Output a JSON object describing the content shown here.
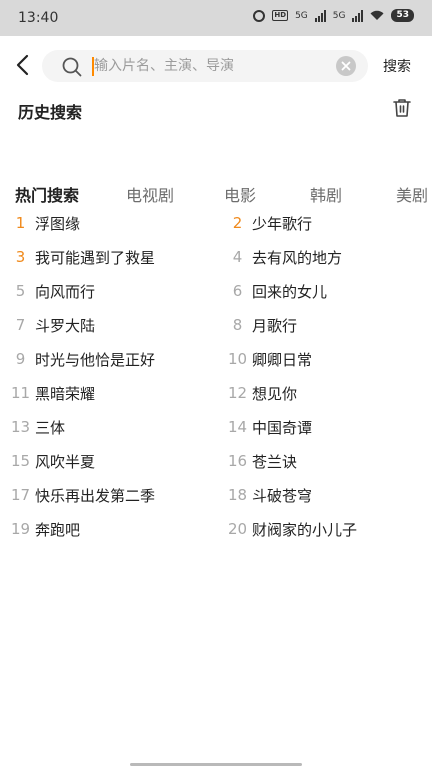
{
  "status_bar": {
    "time": "13:40",
    "hd_tag": "HD",
    "network_1": "5G",
    "network_2": "5G",
    "battery": "53"
  },
  "header": {
    "back_icon": "back-arrow-icon",
    "search": {
      "placeholder": "输入片名、主演、导演",
      "value": "",
      "icon": "search-icon",
      "clear_icon": "clear-icon"
    },
    "submit_label": "搜索"
  },
  "history": {
    "title": "历史搜索",
    "delete_icon": "trash-icon"
  },
  "tabs": [
    {
      "label": "热门搜索",
      "active": true
    },
    {
      "label": "电视剧",
      "active": false
    },
    {
      "label": "电影",
      "active": false
    },
    {
      "label": "韩剧",
      "active": false
    },
    {
      "label": "美剧",
      "active": false
    }
  ],
  "hot_list": [
    {
      "rank": "1",
      "title": "浮图缘",
      "highlight": true
    },
    {
      "rank": "2",
      "title": "少年歌行",
      "highlight": true
    },
    {
      "rank": "3",
      "title": "我可能遇到了救星",
      "highlight": true
    },
    {
      "rank": "4",
      "title": "去有风的地方",
      "highlight": false
    },
    {
      "rank": "5",
      "title": "向风而行",
      "highlight": false
    },
    {
      "rank": "6",
      "title": "回来的女儿",
      "highlight": false
    },
    {
      "rank": "7",
      "title": "斗罗大陆",
      "highlight": false
    },
    {
      "rank": "8",
      "title": "月歌行",
      "highlight": false
    },
    {
      "rank": "9",
      "title": "时光与他恰是正好",
      "highlight": false
    },
    {
      "rank": "10",
      "title": "卿卿日常",
      "highlight": false
    },
    {
      "rank": "11",
      "title": "黑暗荣耀",
      "highlight": false
    },
    {
      "rank": "12",
      "title": "想见你",
      "highlight": false
    },
    {
      "rank": "13",
      "title": "三体",
      "highlight": false
    },
    {
      "rank": "14",
      "title": "中国奇谭",
      "highlight": false
    },
    {
      "rank": "15",
      "title": "风吹半夏",
      "highlight": false
    },
    {
      "rank": "16",
      "title": "苍兰诀",
      "highlight": false
    },
    {
      "rank": "17",
      "title": "快乐再出发第二季",
      "highlight": false
    },
    {
      "rank": "18",
      "title": "斗破苍穹",
      "highlight": false
    },
    {
      "rank": "19",
      "title": "奔跑吧",
      "highlight": false
    },
    {
      "rank": "20",
      "title": "财阀家的小儿子",
      "highlight": false
    }
  ],
  "colors": {
    "accent": "#f08a1c",
    "rank_muted": "#a8a8a8",
    "caret": "#ff8a00"
  }
}
